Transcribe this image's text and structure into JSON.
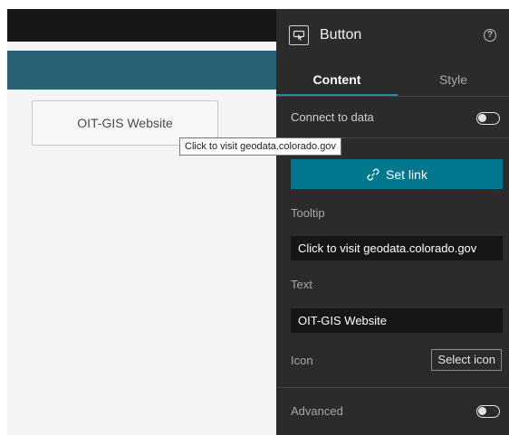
{
  "canvas": {
    "widget_button_label": "OIT-GIS Website",
    "tooltip_popup": "Click to visit geodata.colorado.gov"
  },
  "panel": {
    "title": "Button",
    "widget_icon": "button-widget-icon",
    "help_icon": "help-circle-icon",
    "help_glyph": "?",
    "tabs": [
      {
        "label": "Content",
        "active": true
      },
      {
        "label": "Style",
        "active": false
      }
    ],
    "connect_to_data": {
      "label": "Connect to data",
      "enabled": false
    },
    "set_link": {
      "label": "Set link",
      "icon": "link-icon"
    },
    "tooltip": {
      "label": "Tooltip",
      "value": "Click to visit geodata.colorado.gov"
    },
    "text": {
      "label": "Text",
      "value": "OIT-GIS Website"
    },
    "icon": {
      "label": "Icon",
      "button_label": "Select icon"
    },
    "advanced": {
      "label": "Advanced",
      "enabled": false
    }
  },
  "colors": {
    "accent": "#00778f",
    "header_bar": "#2a6076",
    "panel_bg": "#2b2b2b",
    "input_bg": "#161616"
  }
}
